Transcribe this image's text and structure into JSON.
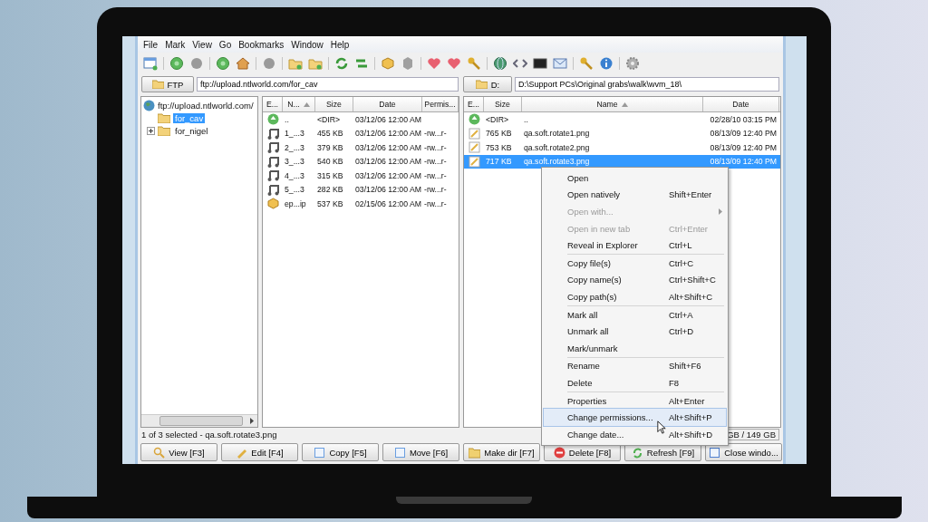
{
  "menu_bar": [
    "File",
    "Mark",
    "View",
    "Go",
    "Bookmarks",
    "Window",
    "Help"
  ],
  "left_panel": {
    "location_button": "FTP",
    "address": "ftp://upload.ntlworld.com/for_cav",
    "tree": [
      {
        "label": "ftp://upload.ntlworld.com/",
        "kind": "server",
        "selected": false,
        "children": [
          {
            "label": "for_cav",
            "kind": "folder",
            "selected": true,
            "expandable": false
          },
          {
            "label": "for_nigel",
            "kind": "folder",
            "selected": false,
            "expandable": true
          }
        ]
      }
    ],
    "columns": [
      {
        "label": "E...",
        "sorted": false
      },
      {
        "label": "N...",
        "sorted": true
      },
      {
        "label": "Size",
        "sorted": false
      },
      {
        "label": "Date",
        "sorted": false
      },
      {
        "label": "Permis...",
        "sorted": false
      }
    ],
    "rows": [
      {
        "kind": "up",
        "name": "..",
        "size": "<DIR>",
        "date": "03/12/06 12:00 AM"
      },
      {
        "kind": "audio",
        "name": "1_...3",
        "size": "455 KB",
        "date": "03/12/06 12:00 AM",
        "permissions": "-rw...r-"
      },
      {
        "kind": "audio",
        "name": "2_...3",
        "size": "379 KB",
        "date": "03/12/06 12:00 AM",
        "permissions": "-rw...r-"
      },
      {
        "kind": "audio",
        "name": "3_...3",
        "size": "540 KB",
        "date": "03/12/06 12:00 AM",
        "permissions": "-rw...r-"
      },
      {
        "kind": "audio",
        "name": "4_...3",
        "size": "315 KB",
        "date": "03/12/06 12:00 AM",
        "permissions": "-rw...r-"
      },
      {
        "kind": "audio",
        "name": "5_...3",
        "size": "282 KB",
        "date": "03/12/06 12:00 AM",
        "permissions": "-rw...r-"
      },
      {
        "kind": "archive",
        "name": "ep...ip",
        "size": "537 KB",
        "date": "02/15/06 12:00 AM",
        "permissions": "-rw...r-"
      }
    ]
  },
  "right_panel": {
    "location_button": "D:",
    "address": "D:\\Support PCs\\Original grabs\\walk\\wvm_18\\",
    "columns": [
      {
        "label": "E...",
        "sorted": false
      },
      {
        "label": "Size",
        "sorted": false
      },
      {
        "label": "Name",
        "sorted": true
      },
      {
        "label": "Date",
        "sorted": false
      }
    ],
    "rows": [
      {
        "kind": "up",
        "size": "<DIR>",
        "name": "..",
        "date": "02/28/10 03:15 PM",
        "selected": false
      },
      {
        "kind": "image",
        "size": "765 KB",
        "name": "qa.soft.rotate1.png",
        "date": "08/13/09 12:40 PM",
        "selected": false
      },
      {
        "kind": "image",
        "size": "753 KB",
        "name": "qa.soft.rotate2.png",
        "date": "08/13/09 12:40 PM",
        "selected": false
      },
      {
        "kind": "image",
        "size": "717 KB",
        "name": "qa.soft.rotate3.png",
        "date": "08/13/09 12:40 PM",
        "selected": true
      }
    ]
  },
  "status_bar": {
    "selection": "1 of 3 selected - qa.soft.rotate3.png",
    "disk_space": "GB / 149 GB"
  },
  "context_menu": [
    {
      "kind": "item",
      "label": "Open",
      "disabled": false,
      "submenu": false,
      "hovered": false
    },
    {
      "kind": "item",
      "label": "Open natively",
      "shortcut": "Shift+Enter",
      "disabled": false,
      "submenu": false,
      "hovered": false
    },
    {
      "kind": "item",
      "label": "Open with...",
      "disabled": true,
      "submenu": true,
      "hovered": false
    },
    {
      "kind": "item",
      "label": "Open in new tab",
      "shortcut": "Ctrl+Enter",
      "disabled": true,
      "submenu": false,
      "hovered": false
    },
    {
      "kind": "item",
      "label": "Reveal in Explorer",
      "shortcut": "Ctrl+L",
      "disabled": false,
      "submenu": false,
      "hovered": false
    },
    {
      "kind": "separator"
    },
    {
      "kind": "item",
      "label": "Copy file(s)",
      "shortcut": "Ctrl+C",
      "disabled": false,
      "submenu": false,
      "hovered": false
    },
    {
      "kind": "item",
      "label": "Copy name(s)",
      "shortcut": "Ctrl+Shift+C",
      "disabled": false,
      "submenu": false,
      "hovered": false
    },
    {
      "kind": "item",
      "label": "Copy path(s)",
      "shortcut": "Alt+Shift+C",
      "disabled": false,
      "submenu": false,
      "hovered": false
    },
    {
      "kind": "separator"
    },
    {
      "kind": "item",
      "label": "Mark all",
      "shortcut": "Ctrl+A",
      "disabled": false,
      "submenu": false,
      "hovered": false
    },
    {
      "kind": "item",
      "label": "Unmark all",
      "shortcut": "Ctrl+D",
      "disabled": false,
      "submenu": false,
      "hovered": false
    },
    {
      "kind": "item",
      "label": "Mark/unmark",
      "disabled": false,
      "submenu": false,
      "hovered": false
    },
    {
      "kind": "separator"
    },
    {
      "kind": "item",
      "label": "Rename",
      "shortcut": "Shift+F6",
      "disabled": false,
      "submenu": false,
      "hovered": false
    },
    {
      "kind": "item",
      "label": "Delete",
      "shortcut": "F8",
      "disabled": false,
      "submenu": false,
      "hovered": false
    },
    {
      "kind": "separator"
    },
    {
      "kind": "item",
      "label": "Properties",
      "shortcut": "Alt+Enter",
      "disabled": false,
      "submenu": false,
      "hovered": false
    },
    {
      "kind": "item",
      "label": "Change permissions...",
      "shortcut": "Alt+Shift+P",
      "disabled": false,
      "submenu": false,
      "hovered": true
    },
    {
      "kind": "item",
      "label": "Change date...",
      "shortcut": "Alt+Shift+D",
      "disabled": false,
      "submenu": false,
      "hovered": false
    }
  ],
  "function_buttons": [
    {
      "label": "View [F3]",
      "kind": "view"
    },
    {
      "label": "Edit [F4]",
      "kind": "edit"
    },
    {
      "label": "Copy [F5]",
      "kind": "copy"
    },
    {
      "label": "Move [F6]",
      "kind": "move"
    },
    {
      "label": "Make dir [F7]",
      "kind": "mkdir"
    },
    {
      "label": "Delete [F8]",
      "kind": "delete"
    },
    {
      "label": "Refresh [F9]",
      "kind": "refresh"
    },
    {
      "label": "Close windo...",
      "kind": "close"
    }
  ]
}
